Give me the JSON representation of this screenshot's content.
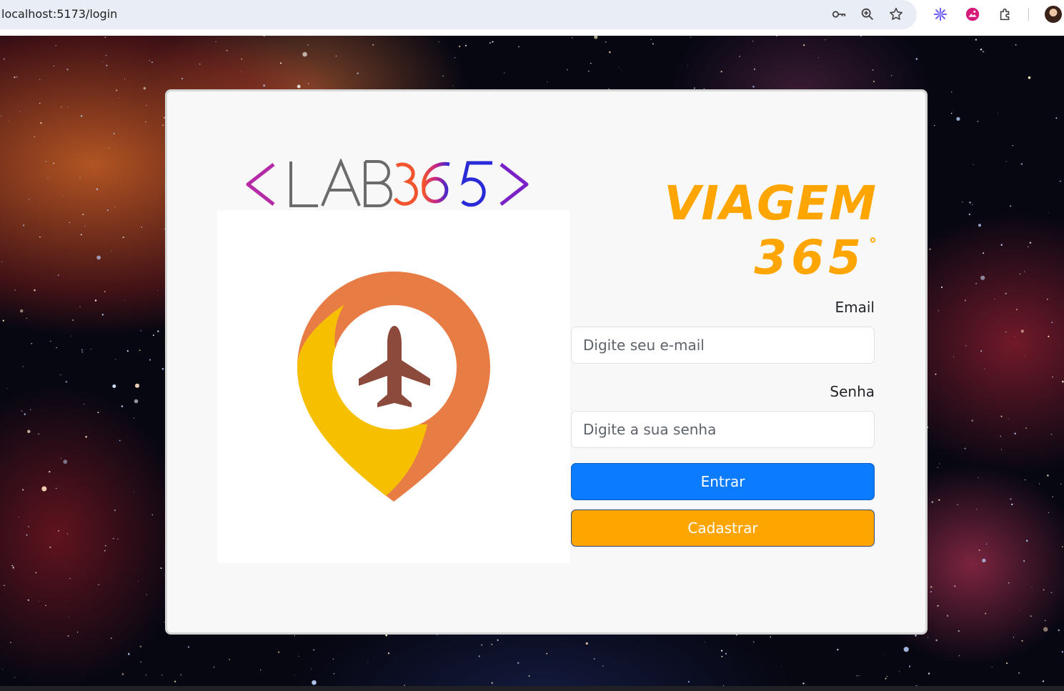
{
  "browser": {
    "url": "localhost:5173/login",
    "toolbar_icons": [
      "key-icon",
      "zoom-icon",
      "star-icon",
      "extension-ai-icon",
      "extension-photo-icon",
      "puzzle-icon",
      "profile-avatar"
    ]
  },
  "brand": {
    "logo_text": "<LAB365>",
    "title_line1": "VIAGEM",
    "title_line2": "365",
    "title_degree": "°",
    "accent_color": "#ffa500",
    "pin_outer_color": "#e87c45",
    "pin_inner_color": "#f6c000",
    "plane_color": "#8b4a3c"
  },
  "form": {
    "email_label": "Email",
    "email_placeholder": "Digite seu e-mail",
    "email_value": "",
    "password_label": "Senha",
    "password_placeholder": "Digite a sua senha",
    "password_value": "",
    "submit_label": "Entrar",
    "submit_color": "#0b7cff",
    "register_label": "Cadastrar",
    "register_color": "#ffa500"
  }
}
